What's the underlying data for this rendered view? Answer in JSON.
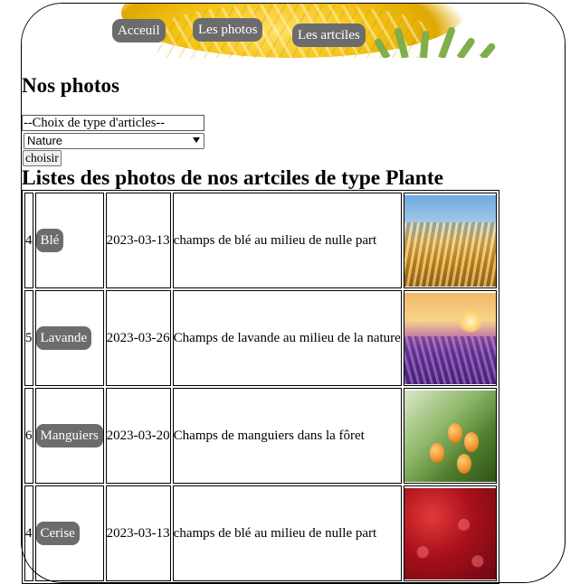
{
  "nav": {
    "items": [
      {
        "label": "Acceuil"
      },
      {
        "label": "Les photos"
      },
      {
        "label": "Les artciles"
      }
    ]
  },
  "page": {
    "title": "Nos photos",
    "type_select_placeholder": "--Choix de type d'articles--",
    "type_select_value": "Nature",
    "choose_button": "choisir",
    "list_title": "Listes des photos de nos artciles de type Plante"
  },
  "table": {
    "rows": [
      {
        "id": "4",
        "name": "Blé",
        "date": "2023-03-13",
        "description": "champs de blé au milieu de nulle part",
        "photo": "wheat-field-photo"
      },
      {
        "id": "5",
        "name": "Lavande",
        "date": "2023-03-26",
        "description": "Champs de lavande au milieu de la nature",
        "photo": "lavender-field-photo"
      },
      {
        "id": "6",
        "name": "Manguiers",
        "date": "2023-03-20",
        "description": "Champs de manguiers dans la fôret",
        "photo": "mango-tree-photo"
      },
      {
        "id": "4",
        "name": "Cerise",
        "date": "2023-03-13",
        "description": "champs de blé au milieu de nulle part",
        "photo": "cherries-photo"
      }
    ]
  },
  "colors": {
    "button_bg": "#6c6c6c",
    "button_text": "#ffffff"
  }
}
